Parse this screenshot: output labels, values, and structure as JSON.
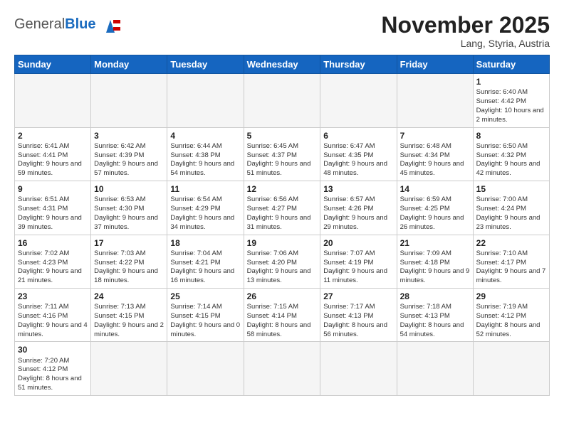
{
  "header": {
    "logo_general": "General",
    "logo_blue": "Blue",
    "month_title": "November 2025",
    "subtitle": "Lang, Styria, Austria"
  },
  "weekdays": [
    "Sunday",
    "Monday",
    "Tuesday",
    "Wednesday",
    "Thursday",
    "Friday",
    "Saturday"
  ],
  "weeks": [
    [
      {
        "day": "",
        "info": ""
      },
      {
        "day": "",
        "info": ""
      },
      {
        "day": "",
        "info": ""
      },
      {
        "day": "",
        "info": ""
      },
      {
        "day": "",
        "info": ""
      },
      {
        "day": "",
        "info": ""
      },
      {
        "day": "1",
        "info": "Sunrise: 6:40 AM\nSunset: 4:42 PM\nDaylight: 10 hours and 2 minutes."
      }
    ],
    [
      {
        "day": "2",
        "info": "Sunrise: 6:41 AM\nSunset: 4:41 PM\nDaylight: 9 hours and 59 minutes."
      },
      {
        "day": "3",
        "info": "Sunrise: 6:42 AM\nSunset: 4:39 PM\nDaylight: 9 hours and 57 minutes."
      },
      {
        "day": "4",
        "info": "Sunrise: 6:44 AM\nSunset: 4:38 PM\nDaylight: 9 hours and 54 minutes."
      },
      {
        "day": "5",
        "info": "Sunrise: 6:45 AM\nSunset: 4:37 PM\nDaylight: 9 hours and 51 minutes."
      },
      {
        "day": "6",
        "info": "Sunrise: 6:47 AM\nSunset: 4:35 PM\nDaylight: 9 hours and 48 minutes."
      },
      {
        "day": "7",
        "info": "Sunrise: 6:48 AM\nSunset: 4:34 PM\nDaylight: 9 hours and 45 minutes."
      },
      {
        "day": "8",
        "info": "Sunrise: 6:50 AM\nSunset: 4:32 PM\nDaylight: 9 hours and 42 minutes."
      }
    ],
    [
      {
        "day": "9",
        "info": "Sunrise: 6:51 AM\nSunset: 4:31 PM\nDaylight: 9 hours and 39 minutes."
      },
      {
        "day": "10",
        "info": "Sunrise: 6:53 AM\nSunset: 4:30 PM\nDaylight: 9 hours and 37 minutes."
      },
      {
        "day": "11",
        "info": "Sunrise: 6:54 AM\nSunset: 4:29 PM\nDaylight: 9 hours and 34 minutes."
      },
      {
        "day": "12",
        "info": "Sunrise: 6:56 AM\nSunset: 4:27 PM\nDaylight: 9 hours and 31 minutes."
      },
      {
        "day": "13",
        "info": "Sunrise: 6:57 AM\nSunset: 4:26 PM\nDaylight: 9 hours and 29 minutes."
      },
      {
        "day": "14",
        "info": "Sunrise: 6:59 AM\nSunset: 4:25 PM\nDaylight: 9 hours and 26 minutes."
      },
      {
        "day": "15",
        "info": "Sunrise: 7:00 AM\nSunset: 4:24 PM\nDaylight: 9 hours and 23 minutes."
      }
    ],
    [
      {
        "day": "16",
        "info": "Sunrise: 7:02 AM\nSunset: 4:23 PM\nDaylight: 9 hours and 21 minutes."
      },
      {
        "day": "17",
        "info": "Sunrise: 7:03 AM\nSunset: 4:22 PM\nDaylight: 9 hours and 18 minutes."
      },
      {
        "day": "18",
        "info": "Sunrise: 7:04 AM\nSunset: 4:21 PM\nDaylight: 9 hours and 16 minutes."
      },
      {
        "day": "19",
        "info": "Sunrise: 7:06 AM\nSunset: 4:20 PM\nDaylight: 9 hours and 13 minutes."
      },
      {
        "day": "20",
        "info": "Sunrise: 7:07 AM\nSunset: 4:19 PM\nDaylight: 9 hours and 11 minutes."
      },
      {
        "day": "21",
        "info": "Sunrise: 7:09 AM\nSunset: 4:18 PM\nDaylight: 9 hours and 9 minutes."
      },
      {
        "day": "22",
        "info": "Sunrise: 7:10 AM\nSunset: 4:17 PM\nDaylight: 9 hours and 7 minutes."
      }
    ],
    [
      {
        "day": "23",
        "info": "Sunrise: 7:11 AM\nSunset: 4:16 PM\nDaylight: 9 hours and 4 minutes."
      },
      {
        "day": "24",
        "info": "Sunrise: 7:13 AM\nSunset: 4:15 PM\nDaylight: 9 hours and 2 minutes."
      },
      {
        "day": "25",
        "info": "Sunrise: 7:14 AM\nSunset: 4:15 PM\nDaylight: 9 hours and 0 minutes."
      },
      {
        "day": "26",
        "info": "Sunrise: 7:15 AM\nSunset: 4:14 PM\nDaylight: 8 hours and 58 minutes."
      },
      {
        "day": "27",
        "info": "Sunrise: 7:17 AM\nSunset: 4:13 PM\nDaylight: 8 hours and 56 minutes."
      },
      {
        "day": "28",
        "info": "Sunrise: 7:18 AM\nSunset: 4:13 PM\nDaylight: 8 hours and 54 minutes."
      },
      {
        "day": "29",
        "info": "Sunrise: 7:19 AM\nSunset: 4:12 PM\nDaylight: 8 hours and 52 minutes."
      }
    ],
    [
      {
        "day": "30",
        "info": "Sunrise: 7:20 AM\nSunset: 4:12 PM\nDaylight: 8 hours and 51 minutes."
      },
      {
        "day": "",
        "info": ""
      },
      {
        "day": "",
        "info": ""
      },
      {
        "day": "",
        "info": ""
      },
      {
        "day": "",
        "info": ""
      },
      {
        "day": "",
        "info": ""
      },
      {
        "day": "",
        "info": ""
      }
    ]
  ]
}
